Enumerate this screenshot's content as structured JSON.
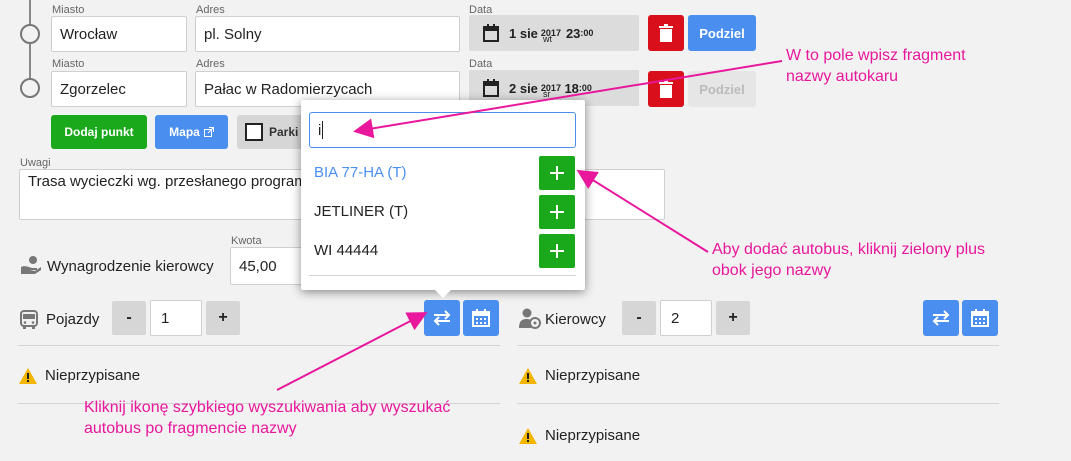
{
  "route": {
    "city_label": "Miasto",
    "address_label": "Adres",
    "date_label": "Data",
    "rows": [
      {
        "city": "Wrocław",
        "address": "pl. Solny",
        "day": "1 sie",
        "year": "2017",
        "weekday": "wt",
        "hour": "23",
        "minute": ":00",
        "split_label": "Podziel"
      },
      {
        "city": "Zgorzelec",
        "address": "Pałac w Radomierzycach",
        "day": "2 sie",
        "year": "2017",
        "weekday": "śr",
        "hour": "18",
        "minute": ":00",
        "split_label": "Podziel"
      }
    ],
    "add_point_label": "Dodaj punkt",
    "map_label": "Mapa",
    "parking_label": "Parki"
  },
  "notes": {
    "label": "Uwagi",
    "value": "Trasa wycieczki wg. przesłanego program"
  },
  "driver_pay": {
    "label": "Wynagrodzenie kierowcy",
    "amount_label": "Kwota",
    "amount": "45,00"
  },
  "vehicles": {
    "label": "Pojazdy",
    "minus": "-",
    "count": "1",
    "plus": "+",
    "unassigned": "Nieprzypisane"
  },
  "drivers": {
    "label": "Kierowcy",
    "minus": "-",
    "count": "2",
    "plus": "+",
    "unassigned": [
      "Nieprzypisane",
      "Nieprzypisane"
    ]
  },
  "dropdown": {
    "search_value": "i",
    "items": [
      {
        "name": "BIA 77-HA (T)",
        "highlighted": true
      },
      {
        "name": "JETLINER (T)",
        "highlighted": false
      },
      {
        "name": "WI 44444",
        "highlighted": false
      }
    ]
  },
  "annotations": {
    "search_hint_1": "W to pole wpisz fragment",
    "search_hint_2": "nazwy autokaru",
    "add_hint_1": "Aby dodać autobus, kliknij zielony plus",
    "add_hint_2": "obok jego nazwy",
    "quick_hint_1": "Kliknij ikonę szybkiego wyszukiwania aby wyszukać",
    "quick_hint_2": "autobus po fragmencie nazwy"
  },
  "colors": {
    "accent": "#4a8ff0",
    "danger": "#d9101c",
    "success": "#1aa91a",
    "annotation": "#e8179c",
    "warning": "#f2b600"
  }
}
